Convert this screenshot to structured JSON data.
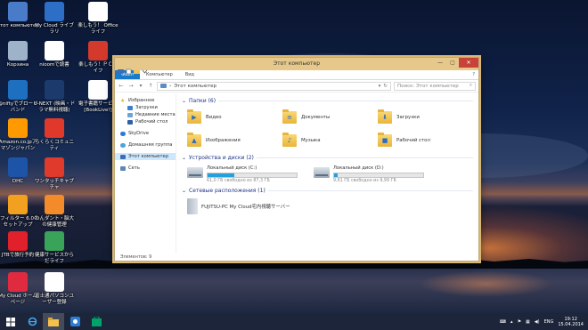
{
  "desktop": {
    "icons": [
      {
        "label": "Этот компьютер",
        "icon": "computer-icon",
        "color": "#4a7bc8"
      },
      {
        "label": "My Cloud ライブラリ",
        "icon": "cloud-library-icon",
        "color": "#2d6fc7"
      },
      {
        "label": "楽しもう！ Office ライフ",
        "icon": "office-icon",
        "color": "#ffffff"
      },
      {
        "label": "Корзина",
        "icon": "recycle-bin-icon",
        "color": "#9fb3c8"
      },
      {
        "label": "nioomで読書",
        "icon": "nioom-icon",
        "color": "#ffffff"
      },
      {
        "label": "楽しもう！ＰＣライフ",
        "icon": "pc-life-icon",
        "color": "#d33a2c"
      },
      {
        "label": "@niftyでブロードバンド",
        "icon": "nifty-icon",
        "color": "#1f6fc1"
      },
      {
        "label": "U-NEXT (映画・ドラマ無料視聴)",
        "icon": "unext-icon",
        "color": "#1c3a6b"
      },
      {
        "label": "電子書籍サービス [BookLive!]",
        "icon": "booklive-icon",
        "color": "#ffffff"
      },
      {
        "label": "Amazon.co.jpアマゾンジャパン",
        "icon": "amazon-icon",
        "color": "#ff9900"
      },
      {
        "label": "らくらくコミュニティ",
        "icon": "community-icon",
        "color": "#e0392b"
      },
      {
        "label": "DHC",
        "icon": "dhc-icon",
        "color": "#1d54a8"
      },
      {
        "label": "ワンタッチキャプチャ",
        "icon": "capture-icon",
        "color": "#e03a2c"
      },
      {
        "label": "i-フィルター 6.0のセットアップ",
        "icon": "ifilter-icon",
        "color": "#f1a020"
      },
      {
        "label": "わんダント・脳大の健康管理",
        "icon": "health-icon",
        "color": "#f38b2a"
      },
      {
        "label": "JTBで旅行予約",
        "icon": "jtb-icon",
        "color": "#e0202a"
      },
      {
        "label": "健康サービスからだライフ",
        "icon": "karada-icon",
        "color": "#3aa35a"
      },
      {
        "label": "My Cloud ホームページ",
        "icon": "mycloud-home-icon",
        "color": "#e02a40"
      },
      {
        "label": "富士通パソコンユーザー登録",
        "icon": "fujitsu-register-icon",
        "color": "#ffffff"
      }
    ]
  },
  "window": {
    "title": "Этот компьютер",
    "ribbon_tabs": [
      "Файл",
      "Компьютер",
      "Вид"
    ],
    "help_icon": "help-icon",
    "address": {
      "path": "Этот компьютер",
      "search_placeholder": "Поиск: Этот компьютер"
    },
    "nav": {
      "favorites": "Избранное",
      "downloads": "Загрузки",
      "recent": "Недавние места",
      "desktop": "Рабочий стол",
      "skydrive": "SkyDrive",
      "homegroup": "Домашняя группа",
      "computer": "Этот компьютер",
      "network": "Сеть"
    },
    "groups": {
      "folders_title": "Папки (6)",
      "devices_title": "Устройства и диски (2)",
      "network_title": "Сетевые расположения (1)"
    },
    "folders": [
      {
        "name": "Видео",
        "badge": "▶"
      },
      {
        "name": "Документы",
        "badge": "≡"
      },
      {
        "name": "Загрузки",
        "badge": "⬇"
      },
      {
        "name": "Изображения",
        "badge": "▲"
      },
      {
        "name": "Музыка",
        "badge": "♪"
      },
      {
        "name": "Рабочий стол",
        "badge": "■"
      }
    ],
    "drives": [
      {
        "name": "Локальный диск (C:)",
        "free_text": "61,0 ГБ свободно из 87,3 ГБ",
        "used_fraction": 0.3
      },
      {
        "name": "Локальный диск (D:)",
        "free_text": "9,61 ГБ свободно из 9,99 ГБ",
        "used_fraction": 0.04
      }
    ],
    "network_locations": [
      {
        "name": "FUJITSU-PC My Cloud宅内視聴サーバー"
      }
    ],
    "status": "Элементов: 9"
  },
  "taskbar": {
    "items": [
      "start-icon",
      "internet-explorer-icon",
      "file-explorer-icon",
      "app-icon",
      "store-icon"
    ],
    "language": "ENG",
    "time": "19:12",
    "date": "15.04.2014"
  }
}
